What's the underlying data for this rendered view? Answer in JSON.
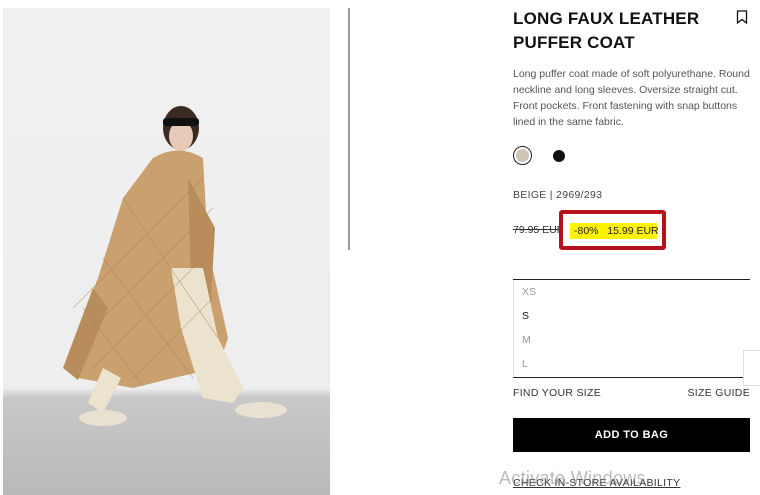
{
  "product": {
    "title_line1": "LONG FAUX LEATHER",
    "title_line2": "PUFFER COAT",
    "description": "Long puffer coat made of soft polyurethane. Round neckline and long sleeves. Oversize straight cut. Front pockets. Front fastening with snap buttons lined in the same fabric.",
    "colors": [
      {
        "name": "beige",
        "hex": "#cfc3b3",
        "selected": true
      },
      {
        "name": "black",
        "hex": "#111111",
        "selected": false
      }
    ],
    "color_reference": "BEIGE | 2969/293",
    "original_price": "79.95 EUR",
    "discount": "-80%",
    "sale_price": "15.99 EUR"
  },
  "sizes": [
    {
      "label": "XS",
      "available": false
    },
    {
      "label": "S",
      "available": true
    },
    {
      "label": "M",
      "available": false
    },
    {
      "label": "L",
      "available": false
    }
  ],
  "links": {
    "find_your_size": "FIND YOUR SIZE",
    "size_guide": "SIZE GUIDE",
    "check_store": "CHECK IN-STORE AVAILABILITY"
  },
  "actions": {
    "add_to_bag": "ADD TO BAG"
  },
  "overlay": {
    "watermark": "Activate Windows"
  },
  "icons": {
    "bookmark": "bookmark-icon"
  },
  "theme": {
    "highlight_border": "#b5121b",
    "highlight_fill": "#fff200",
    "button_bg": "#000000"
  }
}
